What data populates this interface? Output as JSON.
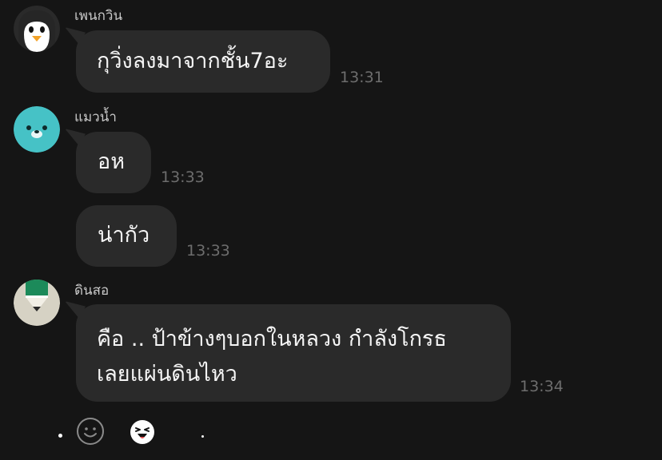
{
  "messages": [
    {
      "sender": "เพนกวิน",
      "avatar_icon": "penguin-avatar-icon",
      "bubbles": [
        {
          "text": "กุวิ่งลงมาจากชั้น7อะ",
          "time": "13:31"
        }
      ]
    },
    {
      "sender": "แมวน้ำ",
      "avatar_icon": "seal-avatar-icon",
      "bubbles": [
        {
          "text": "อห",
          "time": "13:33"
        },
        {
          "text": "น่ากัว",
          "time": "13:33"
        }
      ]
    },
    {
      "sender": "ดินสอ",
      "avatar_icon": "pencil-avatar-icon",
      "bubbles": [
        {
          "text_line1": "คือ .. ป้าข้างๆบอกในหลวง กำลังโกรธ",
          "text_line2": "เลยแผ่นดินไหว",
          "time": "13:34"
        }
      ]
    }
  ],
  "bottom_bar": {
    "emoji_icon": "smiley-icon",
    "sticker_icon": "laughing-sticker-icon"
  },
  "colors": {
    "background": "#151515",
    "bubble": "#2a2a2a",
    "seal": "#46c2c6",
    "pencil_green": "#1c8a5a",
    "pencil_bg": "#d6d2c4"
  }
}
